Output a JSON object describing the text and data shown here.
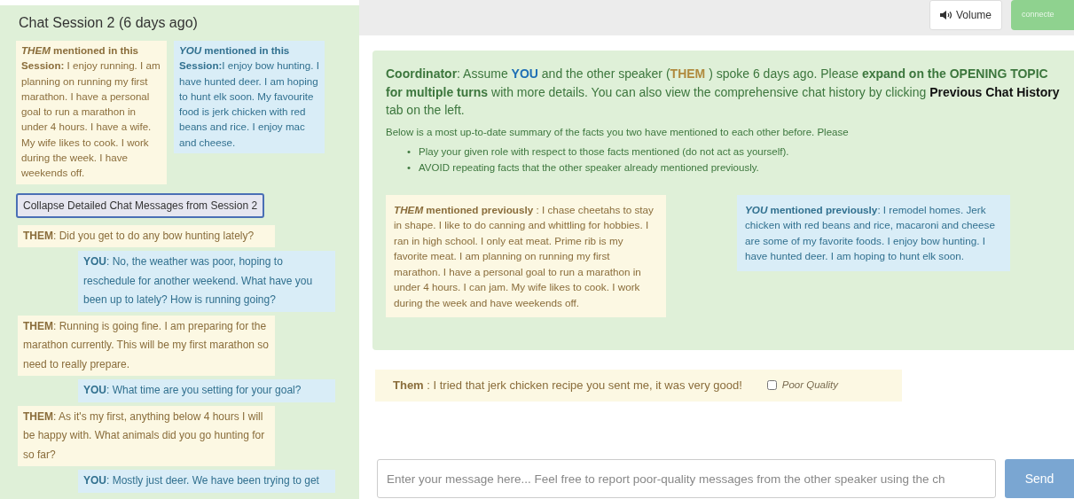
{
  "session": {
    "title": "Chat Session 2 (6 days ago)",
    "summaries": [
      {
        "kind": "them",
        "speaker": "THEM",
        "heading": " mentioned in this Session:",
        "text": " I enjoy running. I am planning on running my first marathon. I have a personal goal to run a marathon in under 4 hours. I have a wife. My wife likes to cook. I work during the week. I have weekends off."
      },
      {
        "kind": "you",
        "speaker": "YOU",
        "heading": " mentioned in this Session:",
        "text": "I enjoy bow hunting. I have hunted deer. I am hoping to hunt elk soon. My favourite food is jerk chicken with red beans and rice. I enjoy mac and cheese."
      }
    ],
    "collapse_button": "Collapse Detailed Chat Messages from Session 2",
    "messages": [
      {
        "kind": "them",
        "speaker": "THEM",
        "text": ": Did you get to do any bow hunting lately?"
      },
      {
        "kind": "you",
        "speaker": "YOU",
        "text": ": No, the weather was poor, hoping to reschedule for another weekend. What have you been up to lately? How is running going?"
      },
      {
        "kind": "them",
        "speaker": "THEM",
        "text": ": Running is going fine. I am preparing for the marathon currently. This will be my first marathon so need to really prepare."
      },
      {
        "kind": "you",
        "speaker": "YOU",
        "text": ": What time are you setting for your goal?"
      },
      {
        "kind": "them",
        "speaker": "THEM",
        "text": ": As it's my first, anything below 4 hours I will be happy with. What animals did you go hunting for so far?"
      },
      {
        "kind": "you",
        "speaker": "YOU",
        "text": ": Mostly just deer. We have been trying to get"
      }
    ]
  },
  "toolbar": {
    "volume_button": "Volume",
    "status_button": "connecte"
  },
  "coordinator": {
    "intro": [
      {
        "kind": "bold",
        "text": "Coordinator"
      },
      {
        "kind": "plain",
        "text": ": Assume "
      },
      {
        "kind": "you",
        "text": "YOU"
      },
      {
        "kind": "plain",
        "text": "  and the other speaker ("
      },
      {
        "kind": "them",
        "text": "THEM"
      },
      {
        "kind": "plain",
        "text": " ) spoke 6 days ago. Please "
      },
      {
        "kind": "bold",
        "text": "expand on the OPENING TOPIC for multiple turns"
      },
      {
        "kind": "plain",
        "text": " with more details. You can also view the comprehensive chat history by clicking "
      },
      {
        "kind": "link",
        "text": "Previous Chat History"
      },
      {
        "kind": "plain",
        "text": " tab on the left."
      }
    ],
    "summary_note": "Below is a most up-to-date summary of the facts you two have mentioned to each other before. Please",
    "rules": [
      {
        "bullet": "•",
        "text": "Play your given role with respect to those facts mentioned (do not act as yourself)."
      },
      {
        "bullet": "•",
        "text": "AVOID repeating facts that the other speaker already mentioned previously."
      }
    ],
    "summaries": [
      {
        "kind": "them",
        "speaker": "THEM",
        "heading": " mentioned previously",
        "text": " : I chase cheetahs to stay in shape. I like to do canning and whittling for hobbies. I ran in high school. I only eat meat. Prime rib is my favorite meat. I am planning on running my first marathon. I have a personal goal to run a marathon in under 4 hours. I can jam. My wife likes to cook. I work during the week and have weekends off."
      },
      {
        "kind": "you",
        "speaker": "YOU",
        "heading": " mentioned previously",
        "text": ": I remodel homes. Jerk chicken with red beans and rice, macaroni and cheese are some of my favorite foods. I enjoy bow hunting. I have hunted deer. I am hoping to hunt elk soon."
      }
    ]
  },
  "latest_message": {
    "speaker": "Them",
    "text": " : I tried that jerk chicken recipe you sent me, it was very good!",
    "poor_quality": {
      "label": "Poor Quality",
      "checked": false
    }
  },
  "composer": {
    "placeholder": "Enter your message here... Feel free to report poor-quality messages from the other speaker using the ch",
    "send_button": "Send"
  }
}
